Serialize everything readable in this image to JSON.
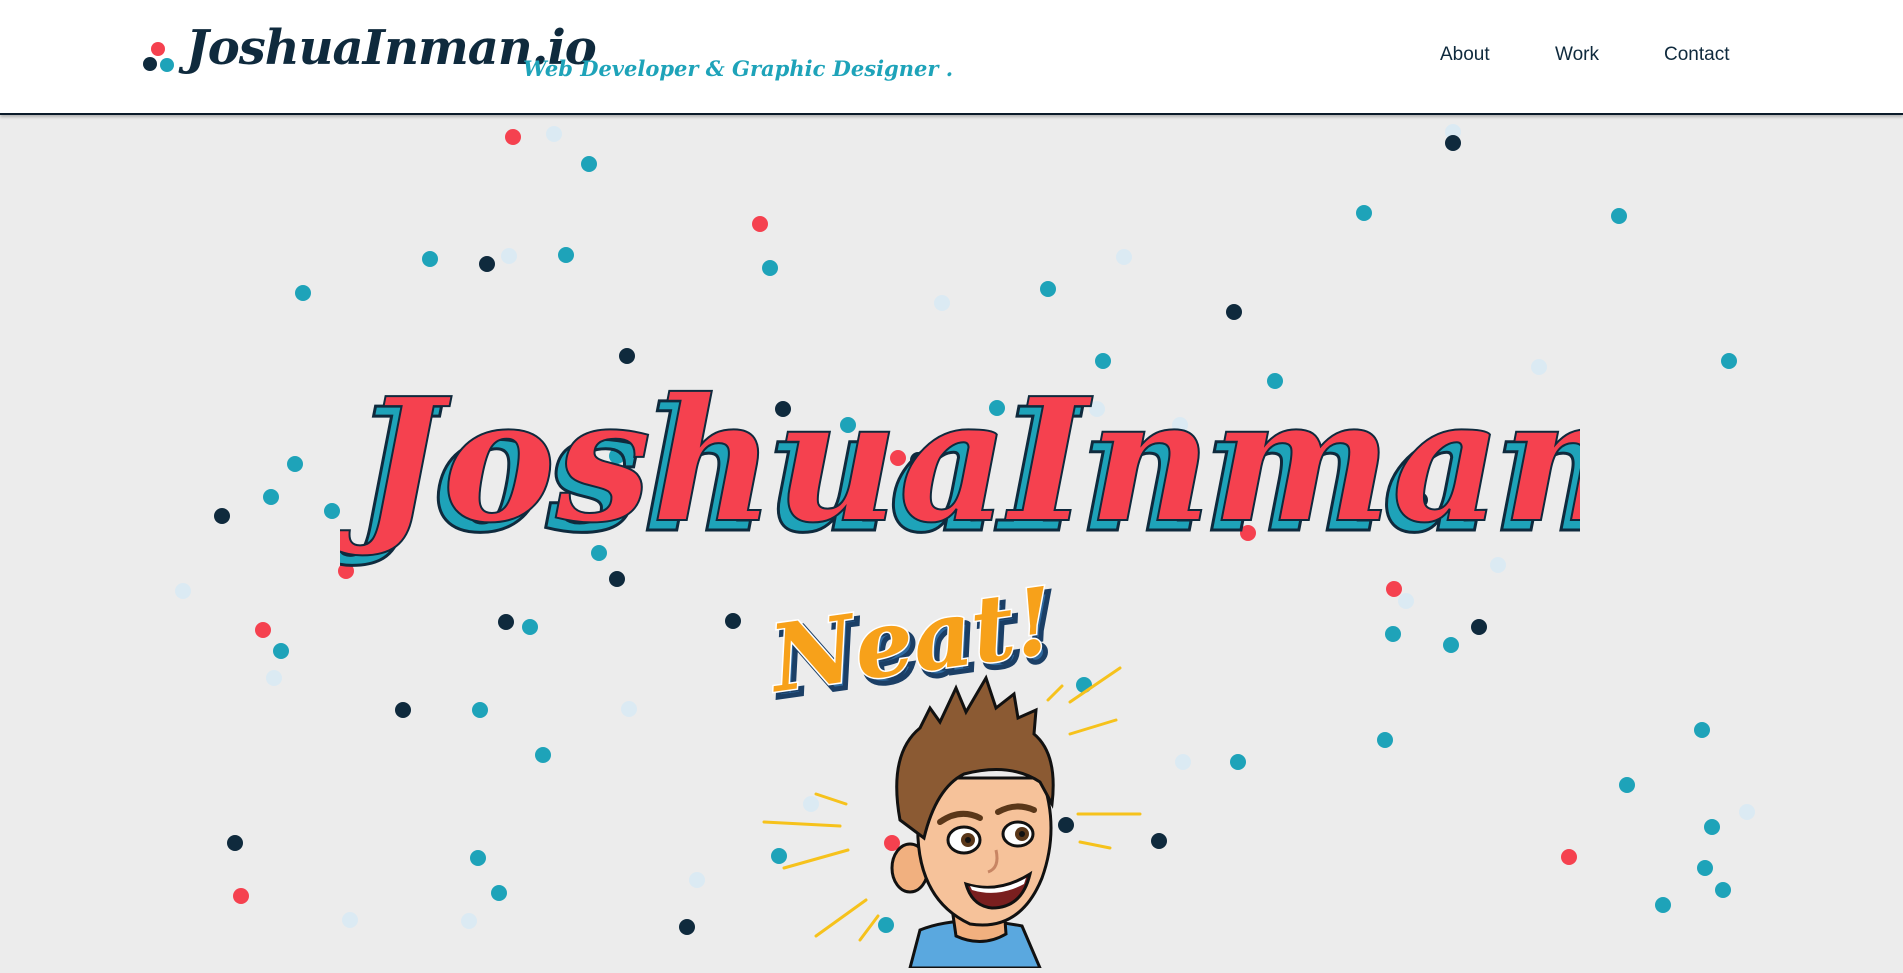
{
  "header": {
    "logo_text": "JoshuaInman.io",
    "tagline": "Web Developer & Graphic Designer ."
  },
  "nav": {
    "items": [
      {
        "label": "About"
      },
      {
        "label": "Work"
      },
      {
        "label": "Contact"
      }
    ]
  },
  "hero": {
    "title": "JoshuaInman.io",
    "sticker_text": "Neat!"
  },
  "colors": {
    "navy": "#0f2a3d",
    "teal": "#1ea3b9",
    "coral": "#f5414f",
    "pale": "#dbeaf3",
    "background": "#ececec",
    "orange": "#f7a11a"
  },
  "icons": {
    "logo_mark": "three-dots-logo-icon"
  }
}
